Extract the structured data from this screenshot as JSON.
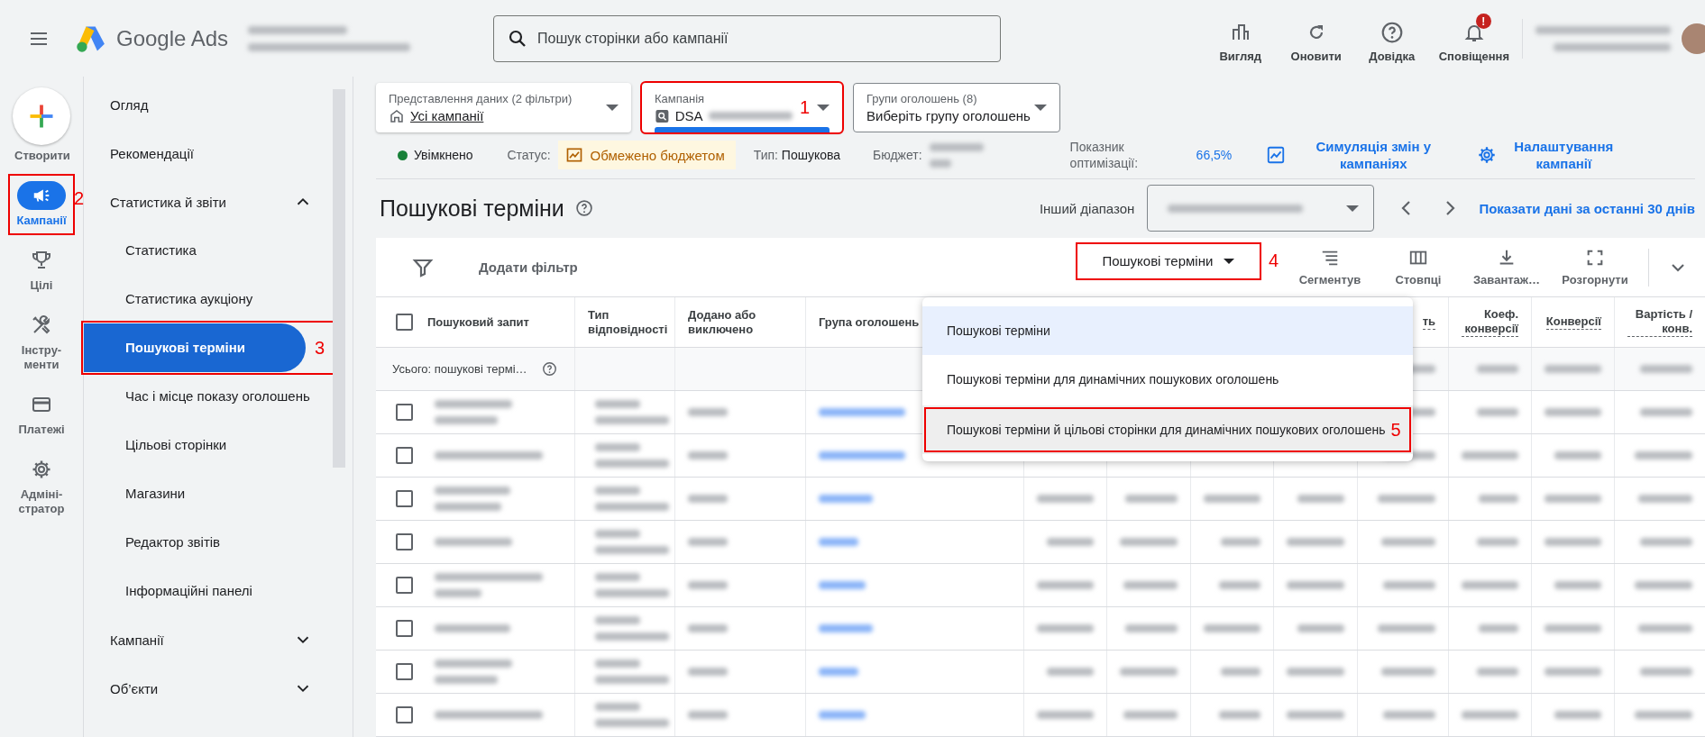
{
  "header": {
    "product": "Google Ads",
    "search": {
      "placeholder": "Пошук сторінки або кампанії"
    },
    "actions": [
      {
        "label": "Вигляд",
        "kind": "view"
      },
      {
        "label": "Оновити",
        "kind": "refresh"
      },
      {
        "label": "Довідка",
        "kind": "help"
      },
      {
        "label": "Сповіщення",
        "kind": "bell",
        "badge": "!"
      }
    ]
  },
  "rail": [
    {
      "label": "Створити",
      "kind": "create",
      "selected": false
    },
    {
      "label": "Кампанії",
      "kind": "campaigns",
      "selected": true,
      "annotation": "2"
    },
    {
      "label": "Цілі",
      "kind": "goals",
      "selected": false
    },
    {
      "label": "Інстру-менти",
      "kind": "tools",
      "selected": false
    },
    {
      "label": "Платежі",
      "kind": "billing",
      "selected": false
    },
    {
      "label": "Адміні-стратор",
      "kind": "admin",
      "selected": false
    }
  ],
  "nav": [
    {
      "label": "Огляд",
      "selected": false
    },
    {
      "label": "Рекомендації",
      "selected": false
    },
    {
      "label": "Статистика й звіти",
      "selected": false,
      "expanded": true,
      "children": [
        {
          "label": "Статистика",
          "selected": false
        },
        {
          "label": "Статистика аукціону",
          "selected": false
        },
        {
          "label": "Пошукові терміни",
          "selected": true,
          "annotation": "3"
        },
        {
          "label": "Час і місце показу оголошень",
          "selected": false
        },
        {
          "label": "Цільові сторінки",
          "selected": false
        },
        {
          "label": "Магазини",
          "selected": false
        },
        {
          "label": "Редактор звітів",
          "selected": false
        },
        {
          "label": "Інформаційні панелі",
          "selected": false
        }
      ]
    },
    {
      "label": "Кампанії",
      "selected": false,
      "expanded": false
    },
    {
      "label": "Об’єкти",
      "selected": false,
      "expanded": false
    }
  ],
  "filters": [
    {
      "label": "Представлення даних (2 фільтри)",
      "value": "Усі кампанії",
      "kind": "home",
      "focused": false
    },
    {
      "label": "Кампанія",
      "value": "DSA",
      "kind": "search",
      "focused": true,
      "annotation": "1"
    },
    {
      "label": "Групи оголошень (8)",
      "value": "Виберіть групу оголошень",
      "focused": false
    }
  ],
  "status": {
    "state": "Увімкнено",
    "enabled": true,
    "status_label": "Статус:",
    "status_badge": "Обмежено бюджетом",
    "type_label": "Тип:",
    "type_value": "Пошукова",
    "budget_label": "Бюджет:",
    "score_label": "Показник оптимізації:",
    "score": "66,5%",
    "links": [
      "Симуляція змін у кампаніях",
      "Налаштування кампанії"
    ]
  },
  "page": {
    "title": "Пошукові терміни",
    "range_label": "Інший діапазон",
    "range_link": "Показати дані за останні 30 днів"
  },
  "toolbar": {
    "filter": "Додати фільтр",
    "view_select": {
      "label": "Пошукові терміни",
      "annotation": "4"
    },
    "tools": [
      {
        "label": "Сегментув",
        "kind": "segment"
      },
      {
        "label": "Стовпці",
        "kind": "columns"
      },
      {
        "label": "Завантаж…",
        "kind": "download"
      },
      {
        "label": "Розгорнути",
        "kind": "expand"
      }
    ]
  },
  "menu": {
    "items": [
      {
        "label": "Пошукові терміни",
        "selected": true,
        "hovered": false
      },
      {
        "label": "Пошукові терміни для динамічних пошукових оголошень",
        "selected": false,
        "hovered": false
      },
      {
        "label": "Пошукові терміни й цільові сторінки для динамічних пошукових оголошень",
        "selected": false,
        "hovered": true,
        "annotation": "5"
      }
    ]
  },
  "table": {
    "all_checked": false,
    "columns": [
      {
        "label": "Пошуковий запит",
        "kind": "text"
      },
      {
        "label": "Тип відповідності",
        "kind": "text"
      },
      {
        "label": "Додано або виключено",
        "kind": "text"
      },
      {
        "label": "Група оголошень",
        "kind": "text"
      },
      {
        "kind": "metric"
      },
      {
        "kind": "metric"
      },
      {
        "kind": "metric"
      },
      {
        "kind": "metric"
      },
      {
        "label": "ть",
        "kind": "metric"
      },
      {
        "label": "Коеф. конверсії",
        "kind": "metric"
      },
      {
        "label": "Конверсії",
        "kind": "metric"
      },
      {
        "label": "Вартість / конв.",
        "kind": "metric"
      }
    ],
    "total": {
      "label": "Усього: пошукові термі…"
    },
    "rows": [
      {
        "checked": false
      },
      {
        "checked": false
      },
      {
        "checked": false
      },
      {
        "checked": false
      },
      {
        "checked": false
      },
      {
        "checked": false
      },
      {
        "checked": false
      },
      {
        "checked": false
      }
    ]
  }
}
